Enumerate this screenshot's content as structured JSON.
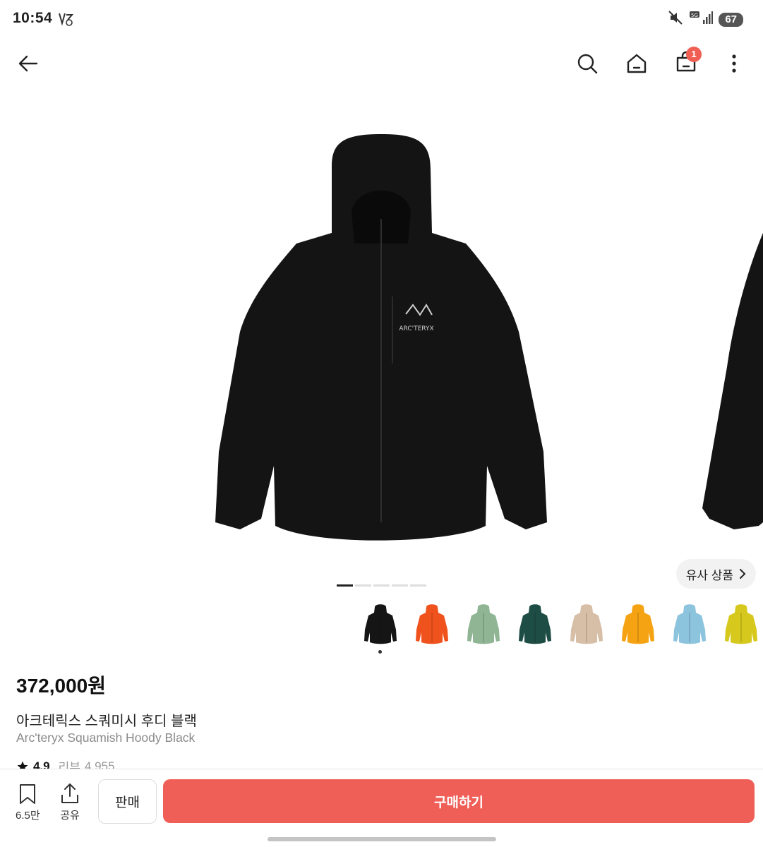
{
  "status_bar": {
    "time": "10:54",
    "battery": "67"
  },
  "nav": {
    "cart_count": "1"
  },
  "gallery": {
    "image_count": 5,
    "active_index": 0,
    "logo_text": "ARC'TERYX",
    "similar_label": "유사 상품"
  },
  "swatches": [
    {
      "name": "black",
      "color": "#151515",
      "selected": true
    },
    {
      "name": "orange",
      "color": "#f0521e"
    },
    {
      "name": "sage",
      "color": "#8fb594"
    },
    {
      "name": "dark-green",
      "color": "#1e4d45"
    },
    {
      "name": "beige",
      "color": "#d7bfa7"
    },
    {
      "name": "yellow",
      "color": "#f5a313"
    },
    {
      "name": "light-blue",
      "color": "#8cc3dd"
    },
    {
      "name": "lime",
      "color": "#d6c81c"
    }
  ],
  "product": {
    "price": "372,000원",
    "title_ko": "아크테릭스 스쿼미시 후디 블랙",
    "title_en": "Arc'teryx Squamish Hoody Black",
    "rating": "4.9",
    "review_label": "리뷰",
    "review_count": "4,955"
  },
  "bottom_bar": {
    "save_count": "6.5만",
    "share_label": "공유",
    "sell_label": "판매",
    "buy_label": "구매하기"
  },
  "colors": {
    "accent": "#ef5f57",
    "badge": "#f15e53"
  }
}
